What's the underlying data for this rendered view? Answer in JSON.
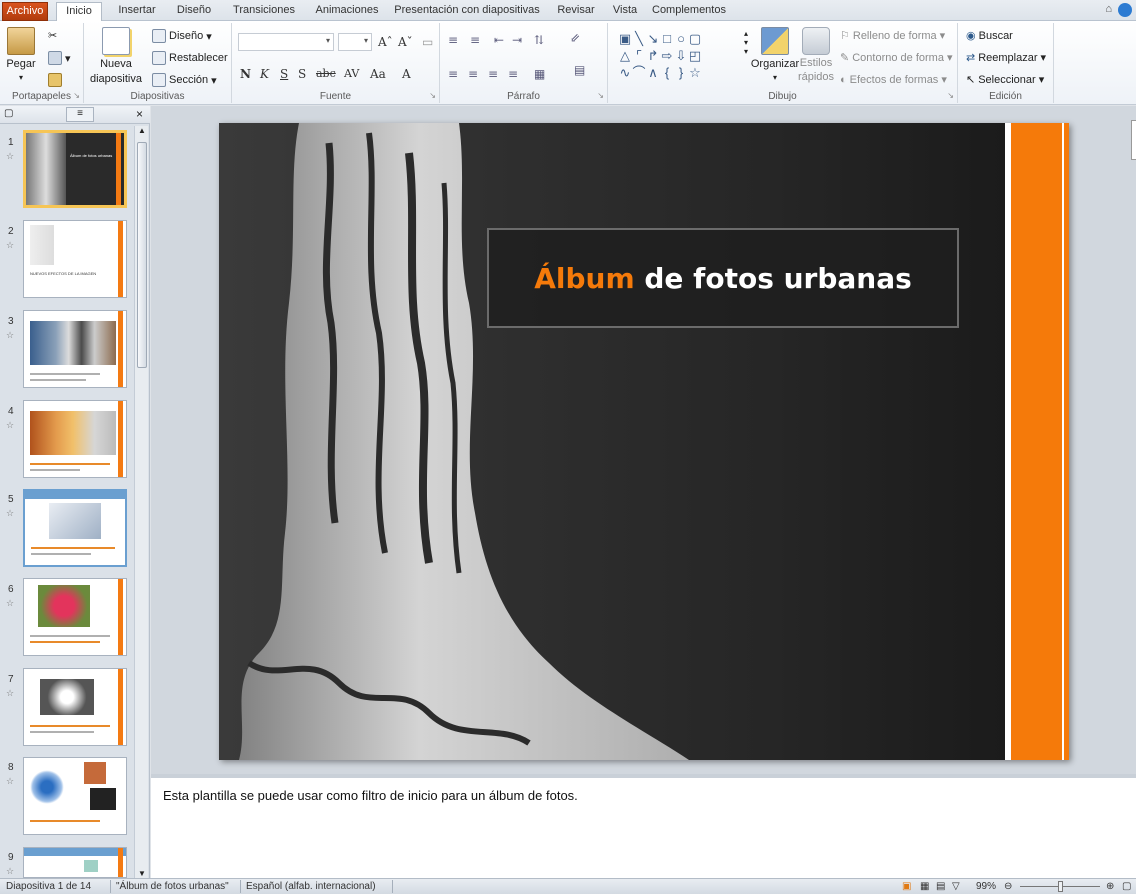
{
  "tabs": [
    "Archivo",
    "Inicio",
    "Insertar",
    "Diseño",
    "Transiciones",
    "Animaciones",
    "Presentación con diapositivas",
    "Revisar",
    "Vista",
    "Complementos"
  ],
  "ribbon": {
    "portapapeles": {
      "label": "Portapapeles",
      "pegar": "Pegar"
    },
    "diapositivas": {
      "label": "Diapositivas",
      "nueva": "Nueva",
      "nueva2": "diapositiva",
      "diseno": "Diseño",
      "restablecer": "Restablecer",
      "seccion": "Sección"
    },
    "fuente": {
      "label": "Fuente",
      "buttons": [
        "N",
        "K",
        "S",
        "S",
        "abc",
        "AV",
        "Aa",
        "A"
      ]
    },
    "parrafo": {
      "label": "Párrafo"
    },
    "dibujo": {
      "label": "Dibujo",
      "organizar": "Organizar",
      "estilos": "Estilos",
      "rapidos": "rápidos",
      "relleno": "Relleno de forma",
      "contorno": "Contorno de forma",
      "efectos": "Efectos de formas"
    },
    "edicion": {
      "label": "Edición",
      "buscar": "Buscar",
      "reemplazar": "Reemplazar",
      "seleccionar": "Seleccionar"
    }
  },
  "thumbnails": [
    {
      "num": "1",
      "text": "Álbum de fotos urbanas"
    },
    {
      "num": "2",
      "text": "NUEVOS EFECTOS DE LA IMAGEN"
    },
    {
      "num": "3",
      "text": ""
    },
    {
      "num": "4",
      "text": ""
    },
    {
      "num": "5",
      "text": ""
    },
    {
      "num": "6",
      "text": ""
    },
    {
      "num": "7",
      "text": ""
    },
    {
      "num": "8",
      "text": ""
    },
    {
      "num": "9",
      "text": ""
    }
  ],
  "slide": {
    "title_accent": "Álbum",
    "title_rest": " de fotos urbanas"
  },
  "notes": "Esta plantilla se puede usar como filtro de inicio para un álbum de fotos.",
  "status": {
    "slide": "Diapositiva 1 de 14",
    "theme": "\"Álbum de fotos urbanas\"",
    "lang": "Español (alfab. internacional)",
    "zoom": "99%"
  },
  "colors": {
    "accent": "#f57a0a",
    "file_tab": "#c84a17"
  }
}
